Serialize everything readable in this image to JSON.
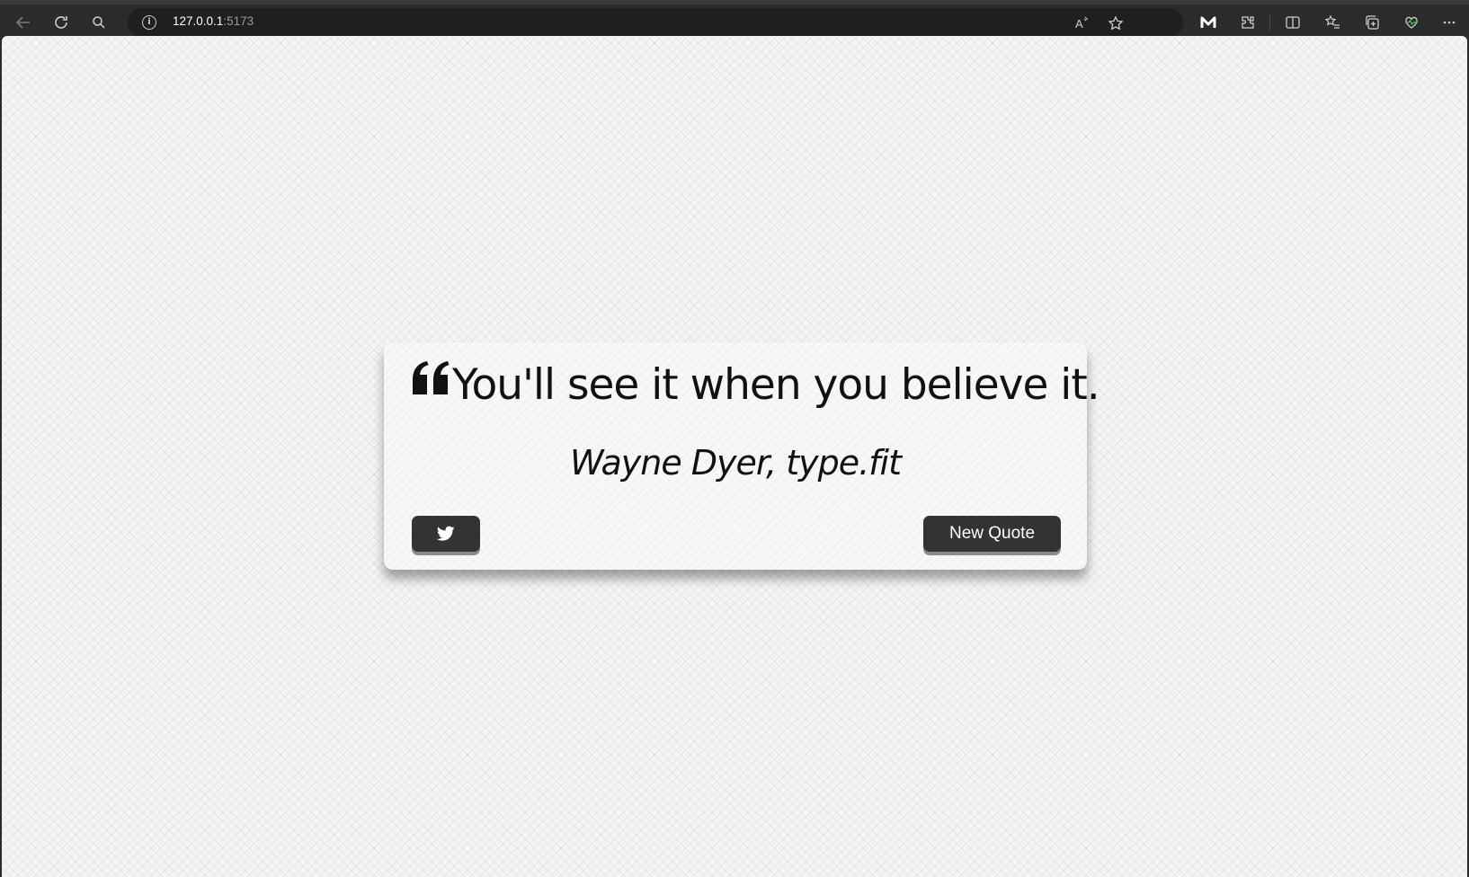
{
  "browser": {
    "url_host": "127.0.0.1",
    "url_port": ":5173",
    "icons": [
      "back-icon",
      "refresh-icon",
      "search-icon",
      "info-icon",
      "read-aloud-icon",
      "favorite-icon",
      "extension-m-icon",
      "extensions-icon",
      "split-screen-icon",
      "favorites-list-icon",
      "collections-icon",
      "health-icon",
      "more-icon"
    ]
  },
  "quote": {
    "text": "You'll see it when you believe it.",
    "author": "Wayne Dyer, type.fit"
  },
  "buttons": {
    "tweet_icon": "twitter-icon",
    "new_quote_label": "New Quote"
  },
  "colors": {
    "button_bg": "#333333",
    "text": "#111111"
  }
}
